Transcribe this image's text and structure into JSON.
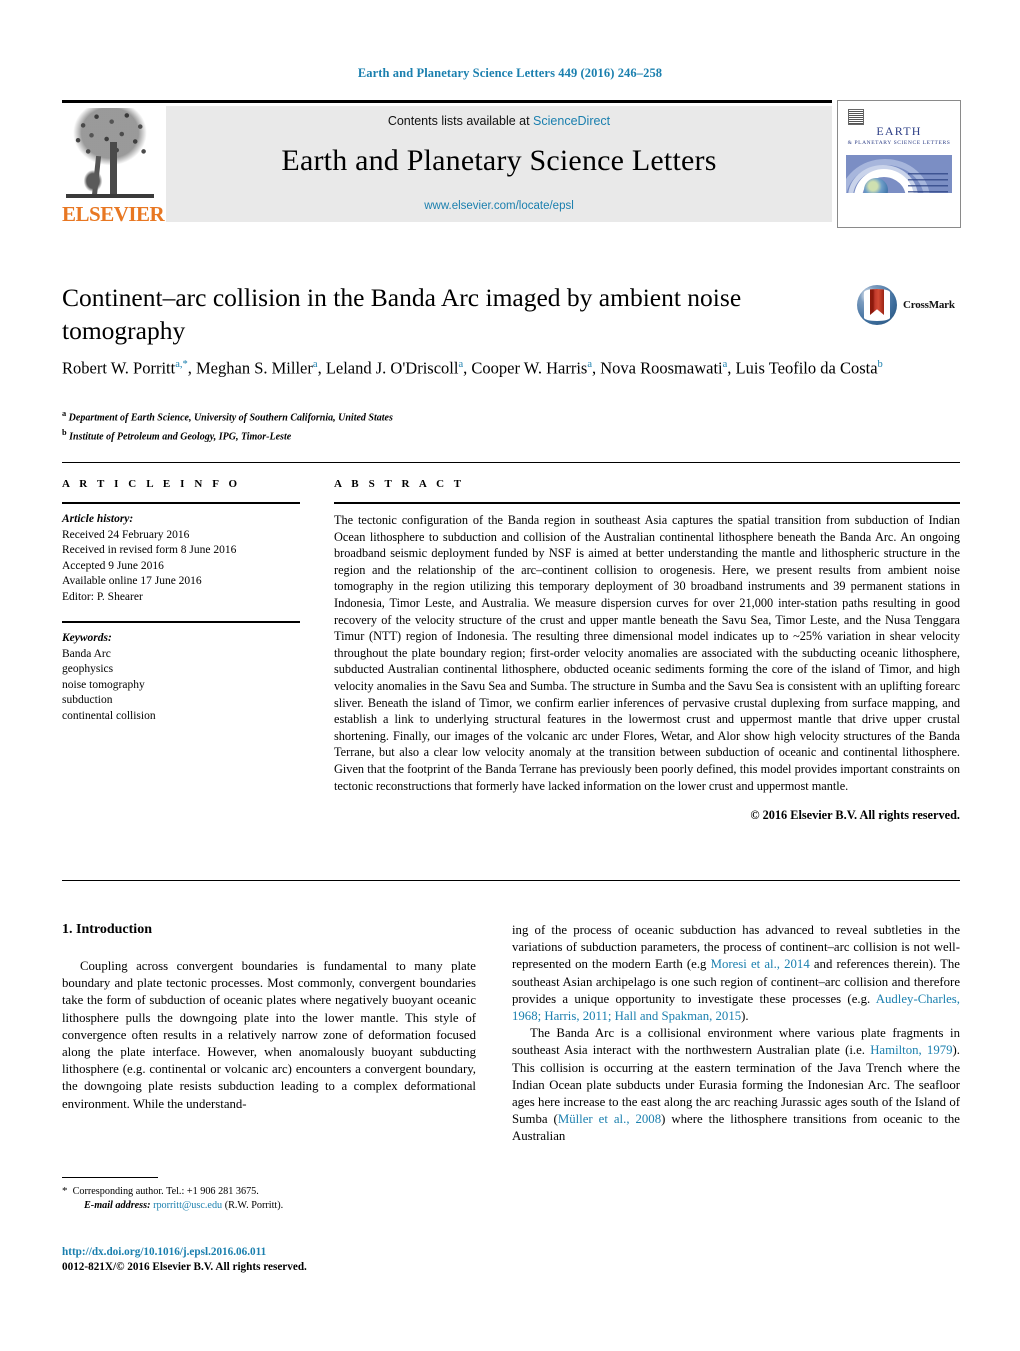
{
  "running_head": "Earth and Planetary Science Letters 449 (2016) 246–258",
  "masthead": {
    "contents_prefix": "Contents lists available at ",
    "sciencedirect_link": "ScienceDirect",
    "journal_title": "Earth and Planetary Science Letters",
    "journal_url": "www.elsevier.com/locate/epsl",
    "publisher": "ELSEVIER",
    "cover": {
      "title": "EARTH",
      "subtitle": "& PLANETARY SCIENCE LETTERS"
    }
  },
  "article": {
    "title": "Continent–arc collision in the Banda Arc imaged by ambient noise tomography",
    "crossmark_label": "CrossMark",
    "authors_line1": "Robert W. Porritt",
    "authors_html": "Robert W. Porritt<sup>a,*</sup>, Meghan S. Miller<sup>a</sup>, Leland J. O'Driscoll<sup>a</sup>, Cooper W. Harris<sup>a</sup>, Nova Roosmawati<sup>a</sup>, Luis Teofilo da Costa<sup>b</sup>",
    "affiliation_a": "Department of Earth Science, University of Southern California, United States",
    "affiliation_b": "Institute of Petroleum and Geology, IPG, Timor-Leste"
  },
  "article_info": {
    "heading": "A R T I C L E   I N F O",
    "history_label": "Article history:",
    "history": [
      "Received 24 February 2016",
      "Received in revised form 8 June 2016",
      "Accepted 9 June 2016",
      "Available online 17 June 2016",
      "Editor: P. Shearer"
    ],
    "keywords_label": "Keywords:",
    "keywords": [
      "Banda Arc",
      "geophysics",
      "noise tomography",
      "subduction",
      "continental collision"
    ]
  },
  "abstract": {
    "heading": "A B S T R A C T",
    "text": "The tectonic configuration of the Banda region in southeast Asia captures the spatial transition from subduction of Indian Ocean lithosphere to subduction and collision of the Australian continental lithosphere beneath the Banda Arc. An ongoing broadband seismic deployment funded by NSF is aimed at better understanding the mantle and lithospheric structure in the region and the relationship of the arc–continent collision to orogenesis. Here, we present results from ambient noise tomography in the region utilizing this temporary deployment of 30 broadband instruments and 39 permanent stations in Indonesia, Timor Leste, and Australia. We measure dispersion curves for over 21,000 inter-station paths resulting in good recovery of the velocity structure of the crust and upper mantle beneath the Savu Sea, Timor Leste, and the Nusa Tenggara Timur (NTT) region of Indonesia. The resulting three dimensional model indicates up to ~25% variation in shear velocity throughout the plate boundary region; first-order velocity anomalies are associated with the subducting oceanic lithosphere, subducted Australian continental lithosphere, obducted oceanic sediments forming the core of the island of Timor, and high velocity anomalies in the Savu Sea and Sumba. The structure in Sumba and the Savu Sea is consistent with an uplifting forearc sliver. Beneath the island of Timor, we confirm earlier inferences of pervasive crustal duplexing from surface mapping, and establish a link to underlying structural features in the lowermost crust and uppermost mantle that drive upper crustal shortening. Finally, our images of the volcanic arc under Flores, Wetar, and Alor show high velocity structures of the Banda Terrane, but also a clear low velocity anomaly at the transition between subduction of oceanic and continental lithosphere. Given that the footprint of the Banda Terrane has previously been poorly defined, this model provides important constraints on tectonic reconstructions that formerly have lacked information on the lower crust and uppermost mantle.",
    "copyright": "© 2016 Elsevier B.V. All rights reserved."
  },
  "body": {
    "section_heading": "1. Introduction",
    "left_paragraph": "Coupling across convergent boundaries is fundamental to many plate boundary and plate tectonic processes. Most commonly, convergent boundaries take the form of subduction of oceanic plates where negatively buoyant oceanic lithosphere pulls the downgoing plate into the lower mantle. This style of convergence often results in a relatively narrow zone of deformation focused along the plate interface. However, when anomalously buoyant subducting lithosphere (e.g. continental or volcanic arc) encounters a convergent boundary, the downgoing plate resists subduction leading to a complex deformational environment. While the understand-",
    "right_paragraph_1_pre": "ing of the process of oceanic subduction has advanced to reveal subtleties in the variations of subduction parameters, the process of continent–arc collision is not well-represented on the modern Earth (e.g ",
    "right_paragraph_1_ref1": "Moresi et al., 2014",
    "right_paragraph_1_mid": " and references therein). The southeast Asian archipelago is one such region of continent–arc collision and therefore provides a unique opportunity to investigate these processes (e.g. ",
    "right_paragraph_1_ref2": "Audley-Charles, 1968; Harris, 2011; Hall and Spakman, 2015",
    "right_paragraph_1_post": ").",
    "right_paragraph_2_pre": "The Banda Arc is a collisional environment where various plate fragments in southeast Asia interact with the northwestern Australian plate (i.e. ",
    "right_paragraph_2_ref1": "Hamilton, 1979",
    "right_paragraph_2_mid": "). This collision is occurring at the eastern termination of the Java Trench where the Indian Ocean plate subducts under Eurasia forming the Indonesian Arc. The seafloor ages here increase to the east along the arc reaching Jurassic ages south of the Island of Sumba (",
    "right_paragraph_2_ref2": "Müller et al., 2008",
    "right_paragraph_2_post": ") where the lithosphere transitions from oceanic to the Australian"
  },
  "footer": {
    "corresponding_star": "*",
    "corresponding_text": "Corresponding author. Tel.: +1 906 281 3675.",
    "email_label": "E-mail address:",
    "email": "rporritt@usc.edu",
    "email_owner": "(R.W. Porritt).",
    "doi": "http://dx.doi.org/10.1016/j.epsl.2016.06.011",
    "issn_line": "0012-821X/© 2016 Elsevier B.V. All rights reserved."
  },
  "colors": {
    "link": "#1a7fae",
    "elsevier_orange": "#e87722",
    "band_gray": "#e9e9e9"
  }
}
